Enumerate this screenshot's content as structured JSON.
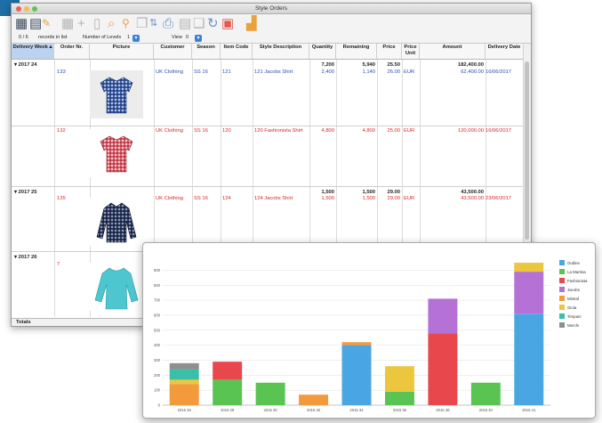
{
  "window": {
    "title": "Style Orders"
  },
  "toolbar": {
    "records_count": "0 / 6",
    "records_label": "records in list",
    "levels_label": "Number of Levels",
    "levels_value": "1",
    "view_label": "View",
    "view_value": "0"
  },
  "columns": {
    "delivery_week": "Delivery Week",
    "order_nr": "Order Nr.",
    "picture": "Picture",
    "customer": "Customer",
    "season": "Season",
    "item_code": "Item Code",
    "style_description": "Style Description",
    "quantity": "Quantity",
    "remaining": "Remaining",
    "price": "Price",
    "price_unit": "Price Unit",
    "amount": "Amount",
    "delivery_date": "Delivery Date"
  },
  "groups": [
    {
      "week": "2017 24",
      "quantity": "7,200",
      "remaining": "5,940",
      "price": "25.50",
      "amount": "182,400.00",
      "rows": [
        {
          "order": "133",
          "customer": "UK Clothing",
          "season": "SS 16",
          "item": "121",
          "style": "121 Jacobs Shirt",
          "quantity": "2,400",
          "remaining": "1,140",
          "price": "26.00",
          "unit": "EUR",
          "amount": "62,400.00",
          "date": "16/06/2017",
          "color": "blue"
        },
        {
          "order": "132",
          "customer": "UK Clothing",
          "season": "SS 16",
          "item": "120",
          "style": "120 Fashionista Shirt",
          "quantity": "4,800",
          "remaining": "4,800",
          "price": "25.00",
          "unit": "EUR",
          "amount": "120,000.00",
          "date": "16/06/2017",
          "color": "red"
        }
      ]
    },
    {
      "week": "2017 25",
      "quantity": "1,500",
      "remaining": "1,500",
      "price": "29.00",
      "amount": "43,500.00",
      "rows": [
        {
          "order": "135",
          "customer": "UK Clothing",
          "season": "SS 16",
          "item": "124",
          "style": "124 Jacobs Shirt",
          "quantity": "1,500",
          "remaining": "1,500",
          "price": "29.00",
          "unit": "EUR",
          "amount": "43,500.00",
          "date": "23/06/2017",
          "color": "red"
        }
      ]
    },
    {
      "week": "2017 26",
      "rows": [
        {
          "order": "7",
          "color": "red"
        }
      ]
    }
  ],
  "footer": {
    "totals_label": "Totals"
  },
  "colors": {
    "outline": "#4aa6e3",
    "la_martina": "#59c452",
    "fashionista": "#e8474c",
    "jacobs": "#b571d6",
    "mistral": "#f29a3c",
    "gioia": "#ecc63c",
    "timpani": "#3bbfa8",
    "merchi": "#8f8f8f"
  },
  "chart_data": {
    "type": "bar",
    "stacked": true,
    "categories": [
      "2015 25",
      "2015 28",
      "2015 30",
      "2015 33",
      "2015 34",
      "2015 35",
      "2015 38",
      "2015 40",
      "2015 41"
    ],
    "y_ticks": [
      "0",
      "100",
      "200",
      "300",
      "400",
      "500",
      "600",
      "700",
      "800",
      "900"
    ],
    "ylim": [
      0,
      950
    ],
    "legend_position": "right",
    "grid": true,
    "series": [
      {
        "name": "Outline",
        "color": "#4aa6e3",
        "values": [
          0,
          0,
          0,
          0,
          400,
          0,
          0,
          0,
          610
        ]
      },
      {
        "name": "La Martina",
        "color": "#59c452",
        "values": [
          0,
          170,
          150,
          0,
          0,
          90,
          0,
          150,
          0
        ]
      },
      {
        "name": "Fashionista",
        "color": "#e8474c",
        "values": [
          0,
          120,
          0,
          0,
          0,
          0,
          480,
          0,
          0
        ]
      },
      {
        "name": "Jacobs",
        "color": "#b571d6",
        "values": [
          0,
          0,
          0,
          0,
          0,
          0,
          230,
          0,
          280
        ]
      },
      {
        "name": "Mistral",
        "color": "#f29a3c",
        "values": [
          140,
          0,
          0,
          70,
          20,
          0,
          0,
          0,
          0
        ]
      },
      {
        "name": "Gioia",
        "color": "#ecc63c",
        "values": [
          30,
          0,
          0,
          0,
          0,
          170,
          0,
          0,
          60
        ]
      },
      {
        "name": "Timpani",
        "color": "#3bbfa8",
        "values": [
          70,
          0,
          0,
          0,
          0,
          0,
          0,
          0,
          0
        ]
      },
      {
        "name": "Merchi",
        "color": "#8f8f8f",
        "values": [
          40,
          0,
          0,
          0,
          0,
          0,
          0,
          0,
          0
        ]
      }
    ]
  }
}
